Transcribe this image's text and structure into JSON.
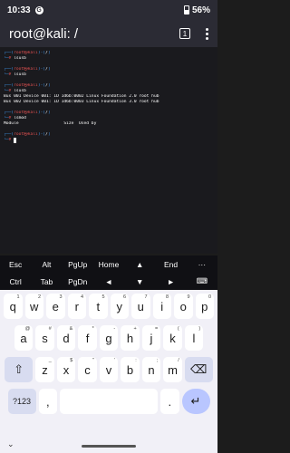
{
  "status_bar": {
    "time": "10:33",
    "app_icon": "G",
    "battery": "56%"
  },
  "toolbar": {
    "title": "root@kali: /",
    "tabs_count": "1"
  },
  "terminal": {
    "lines": [
      "┌──(root㉿kali)-[/]",
      "└─# lsusb",
      "",
      "┌──(root㉿kali)-[/]",
      "└─# lsusb",
      "",
      "┌──(root㉿kali)-[/]",
      "└─# lsusb",
      "Bus 001 Device 001: ID 1d6b:0002 Linux Foundation 2.0 root hub",
      "Bus 002 Device 001: ID 1d6b:0003 Linux Foundation 3.0 root hub",
      "",
      "┌──(root㉿kali)-[/]",
      "└─# lsmod",
      "Module                  Size  Used by",
      "",
      "┌──(root㉿kali)-[/]",
      "└─# "
    ]
  },
  "extra_keys": {
    "row1": [
      "Esc",
      "Alt",
      "PgUp",
      "Home",
      "▲",
      "End",
      "···"
    ],
    "row2": [
      "Ctrl",
      "Tab",
      "PgDn",
      "◄",
      "▼",
      "►",
      "⌨"
    ]
  },
  "keyboard": {
    "row1": [
      {
        "k": "q",
        "a": "1"
      },
      {
        "k": "w",
        "a": "2"
      },
      {
        "k": "e",
        "a": "3"
      },
      {
        "k": "r",
        "a": "4"
      },
      {
        "k": "t",
        "a": "5"
      },
      {
        "k": "y",
        "a": "6"
      },
      {
        "k": "u",
        "a": "7"
      },
      {
        "k": "i",
        "a": "8"
      },
      {
        "k": "o",
        "a": "9"
      },
      {
        "k": "p",
        "a": "0"
      }
    ],
    "row2": [
      {
        "k": "a",
        "a": "@"
      },
      {
        "k": "s",
        "a": "#"
      },
      {
        "k": "d",
        "a": "&"
      },
      {
        "k": "f",
        "a": "*"
      },
      {
        "k": "g",
        "a": "-"
      },
      {
        "k": "h",
        "a": "+"
      },
      {
        "k": "j",
        "a": "="
      },
      {
        "k": "k",
        "a": "("
      },
      {
        "k": "l",
        "a": ")"
      }
    ],
    "row3": [
      {
        "k": "z",
        "a": "_"
      },
      {
        "k": "x",
        "a": "$"
      },
      {
        "k": "c",
        "a": "\""
      },
      {
        "k": "v",
        "a": "'"
      },
      {
        "k": "b",
        "a": ":"
      },
      {
        "k": "n",
        "a": ";"
      },
      {
        "k": "m",
        "a": "/"
      }
    ],
    "shift": "⇧",
    "backspace": "⌫",
    "symbols": "?123",
    "comma": ",",
    "period": ".",
    "enter": "↵",
    "toggle": "⌄"
  }
}
